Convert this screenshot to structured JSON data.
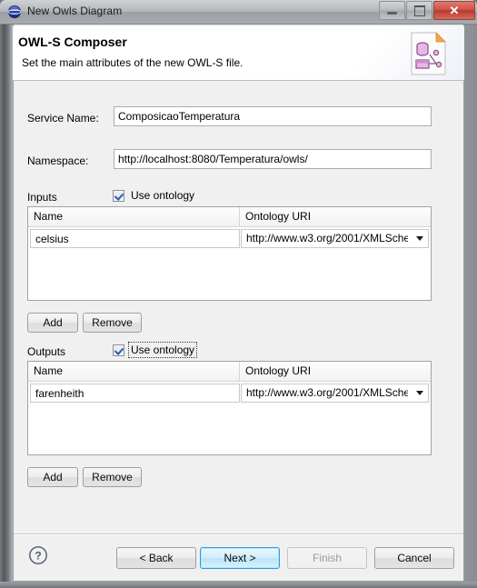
{
  "window": {
    "title": "New Owls Diagram",
    "app_icon": "globe-icon",
    "minimize_label": "Minimize",
    "maximize_label": "Maximize",
    "close_label": "Close",
    "close_glyph": "✕"
  },
  "header": {
    "title": "OWL-S Composer",
    "subtitle": "Set the main attributes of the new OWL-S file.",
    "banner_icon": "owls-document-icon"
  },
  "form": {
    "service_name": {
      "label": "Service Name:",
      "value": "ComposicaoTemperatura",
      "placeholder": ""
    },
    "namespace": {
      "label": "Namespace:",
      "value": "http://localhost:8080/Temperatura/owls/",
      "placeholder": ""
    },
    "inputs": {
      "label": "Inputs",
      "use_ontology_label": "Use ontology",
      "use_ontology_checked": true,
      "focused": false,
      "columns": [
        "Name",
        "Ontology URI"
      ],
      "rows": [
        {
          "name": "celsius",
          "ontology_uri": "http://www.w3.org/2001/XMLSche"
        }
      ],
      "add_label": "Add",
      "remove_label": "Remove"
    },
    "outputs": {
      "label": "Outputs",
      "use_ontology_label": "Use ontology",
      "use_ontology_checked": true,
      "focused": true,
      "columns": [
        "Name",
        "Ontology URI"
      ],
      "rows": [
        {
          "name": "farenheith",
          "ontology_uri": "http://www.w3.org/2001/XMLSche"
        }
      ],
      "add_label": "Add",
      "remove_label": "Remove"
    }
  },
  "footer": {
    "help_icon": "help-question-icon",
    "buttons": {
      "back": {
        "label": "< Back",
        "mnemonic": "B",
        "enabled": true,
        "default": false
      },
      "next": {
        "label": "Next >",
        "mnemonic": "N",
        "enabled": true,
        "default": true
      },
      "finish": {
        "label": "Finish",
        "mnemonic": "F",
        "enabled": false,
        "default": false
      },
      "cancel": {
        "label": "Cancel",
        "mnemonic": "",
        "enabled": true,
        "default": false
      }
    }
  },
  "colors": {
    "dialog_bg": "#f0f0f0",
    "header_bg": "#ffffff",
    "accent_default_button": "#2e9adf",
    "close_button": "#c1432f",
    "checkbox_check": "#2a5ca8"
  }
}
